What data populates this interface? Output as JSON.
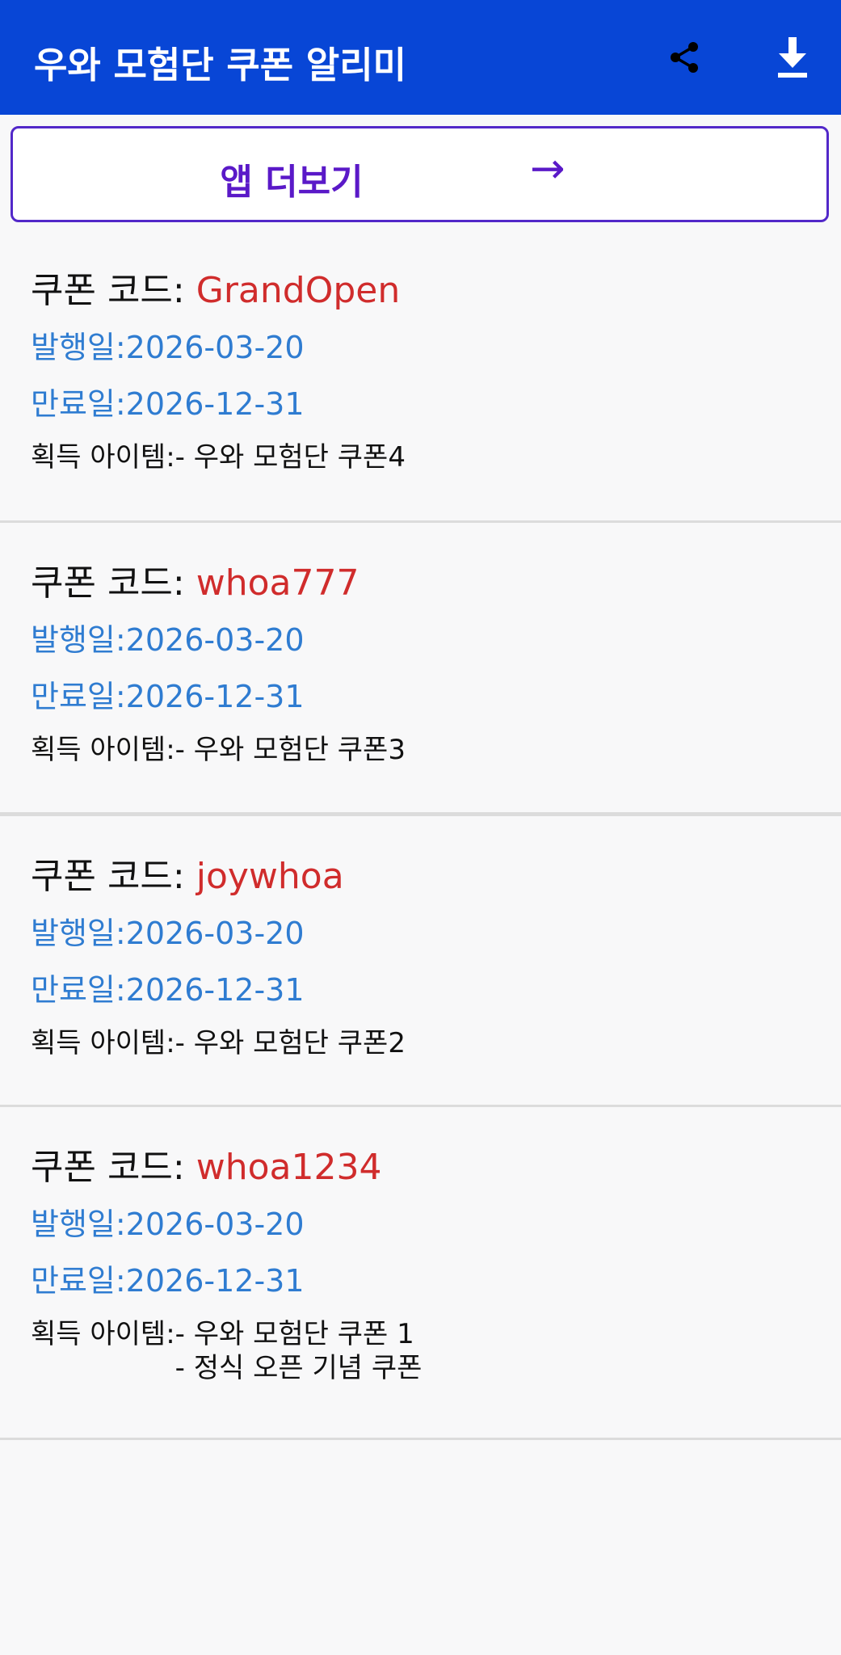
{
  "appbar": {
    "title": "우와 모험단 쿠폰 알리미",
    "share_icon": "share-icon",
    "download_icon": "download-icon",
    "background": "#0846d6"
  },
  "more_button": {
    "label": "앱 더보기",
    "arrow": "→",
    "color": "#5a19c8"
  },
  "coupons": [
    {
      "code_label": "쿠폰 코드:",
      "code": "GrandOpen",
      "issued": "발행일:2026-03-20",
      "expires": "만료일:2026-12-31",
      "items_label": "획득 아이템:",
      "items": [
        "- 우와 모험단 쿠폰4"
      ]
    },
    {
      "code_label": "쿠폰 코드:",
      "code": "whoa777",
      "issued": "발행일:2026-03-20",
      "expires": "만료일:2026-12-31",
      "items_label": "획득 아이템:",
      "items": [
        "- 우와 모험단 쿠폰3"
      ]
    },
    {
      "code_label": "쿠폰 코드:",
      "code": "joywhoa",
      "issued": "발행일:2026-03-20",
      "expires": "만료일:2026-12-31",
      "items_label": "획득 아이템:",
      "items": [
        "- 우와 모험단 쿠폰2"
      ]
    },
    {
      "code_label": "쿠폰 코드:",
      "code": "whoa1234",
      "issued": "발행일:2026-03-20",
      "expires": "만료일:2026-12-31",
      "items_label": "획득 아이템:",
      "items": [
        "- 우와 모험단 쿠폰 1",
        "- 정식 오픈 기념 쿠폰"
      ]
    }
  ]
}
